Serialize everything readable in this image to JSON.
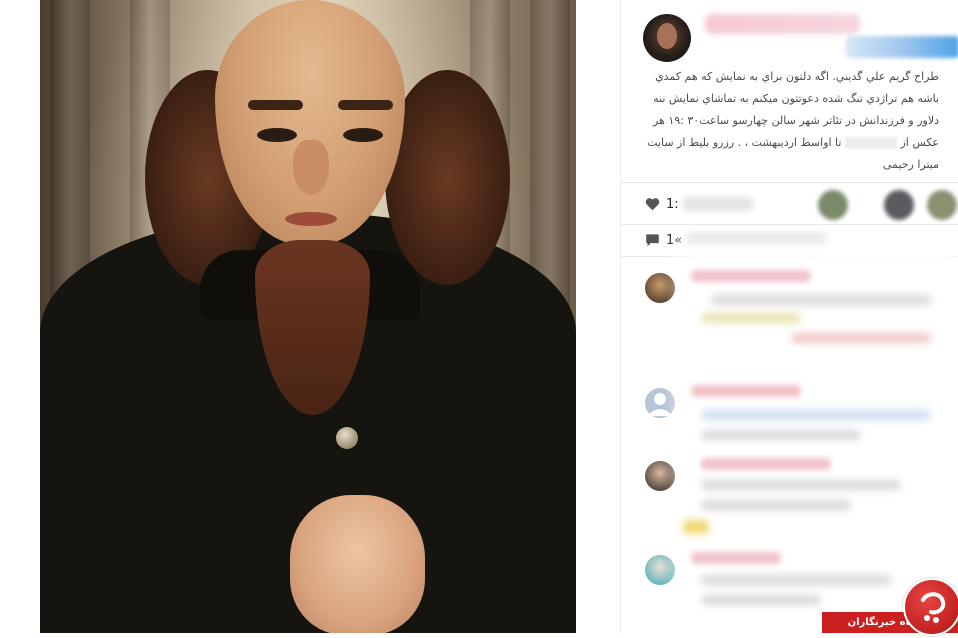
{
  "post": {
    "caption_lines": [
      "طراح گریم علي گدیني. اگه دلتون براي به نمایش که هم کمدي",
      "باشه هم تراژدي تنگ شده دعوتتون میکنم به تماشاي نمایش ننه",
      "دلاور و فرزندانش در تئاتر شهر سالن چهارسو ساعت۳۰ :۱۹ هر",
      "عکس از",
      "تا اواسط اردیبهشت ، . رزرو بلیط از سایت",
      "میترا رحیمی"
    ],
    "likes_count_visible": "1:",
    "comments_count_visible": "1«"
  },
  "icons": {
    "like": "heart-icon",
    "comment": "speech-bubble-icon",
    "watermark": "club-logo-icon"
  },
  "watermark": {
    "label": "باشگاه خبرنگاران",
    "color": "#cc1f1f"
  },
  "colors": {
    "accent_red": "#cc1f1f",
    "follow_blue": "#4da3e6",
    "text": "#262626"
  }
}
